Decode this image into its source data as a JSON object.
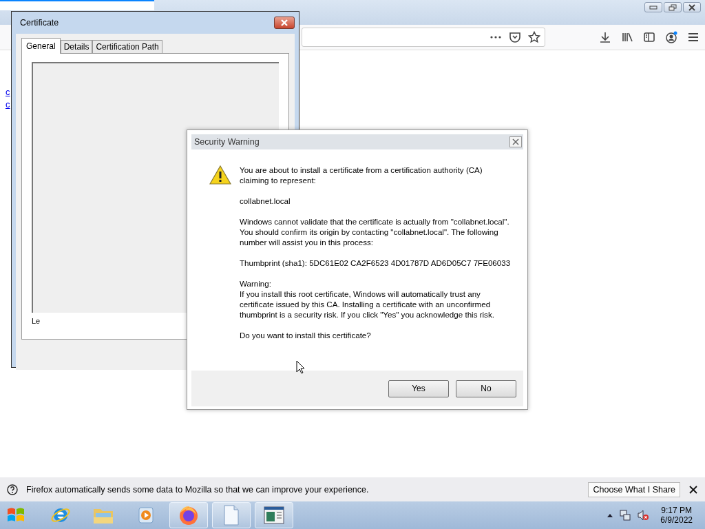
{
  "browser": {
    "tab": {
      "selected": true
    },
    "page": {
      "links": [
        "c",
        "c"
      ]
    },
    "notification": {
      "message": "Firefox automatically sends some data to Mozilla so that we can improve your experience.",
      "button": "Choose What I Share"
    }
  },
  "certificate_window": {
    "title": "Certificate",
    "tabs": [
      {
        "label": "General",
        "selected": true
      },
      {
        "label": "Details",
        "selected": false
      },
      {
        "label": "Certification Path",
        "selected": false
      }
    ],
    "label": "Le"
  },
  "security_warning": {
    "title": "Security Warning",
    "paragraphs": [
      {
        "kind": "body",
        "text": "You are about to install a certificate from a certification authority (CA) claiming to represent:"
      },
      {
        "kind": "body",
        "text": "collabnet.local"
      },
      {
        "kind": "body",
        "text": "Windows cannot validate that the certificate is actually from \"collabnet.local\". You should confirm its origin by contacting \"collabnet.local\". The following number will assist you in this process:"
      },
      {
        "kind": "body",
        "text": "Thumbprint (sha1): 5DC61E02 CA2F6523 4D01787D AD6D05C7 7FE06033"
      },
      {
        "kind": "heading",
        "text": "Warning:"
      },
      {
        "kind": "body",
        "text": "If you install this root certificate, Windows will automatically trust any certificate issued by this CA. Installing a certificate with an unconfirmed thumbprint is a security risk. If you click \"Yes\" you acknowledge this risk."
      },
      {
        "kind": "body",
        "text": "Do you want to install this certificate?"
      }
    ],
    "buttons": [
      "Yes",
      "No"
    ]
  },
  "taskbar": {
    "apps": [
      {
        "kind": "ie",
        "running": false
      },
      {
        "kind": "folder",
        "running": false
      },
      {
        "kind": "media",
        "running": false
      },
      {
        "kind": "firefox",
        "running": true
      },
      {
        "kind": "document",
        "running": true
      },
      {
        "kind": "window",
        "running": true
      }
    ],
    "clock": {
      "time": "9:17 PM",
      "date": "6/9/2022"
    }
  }
}
